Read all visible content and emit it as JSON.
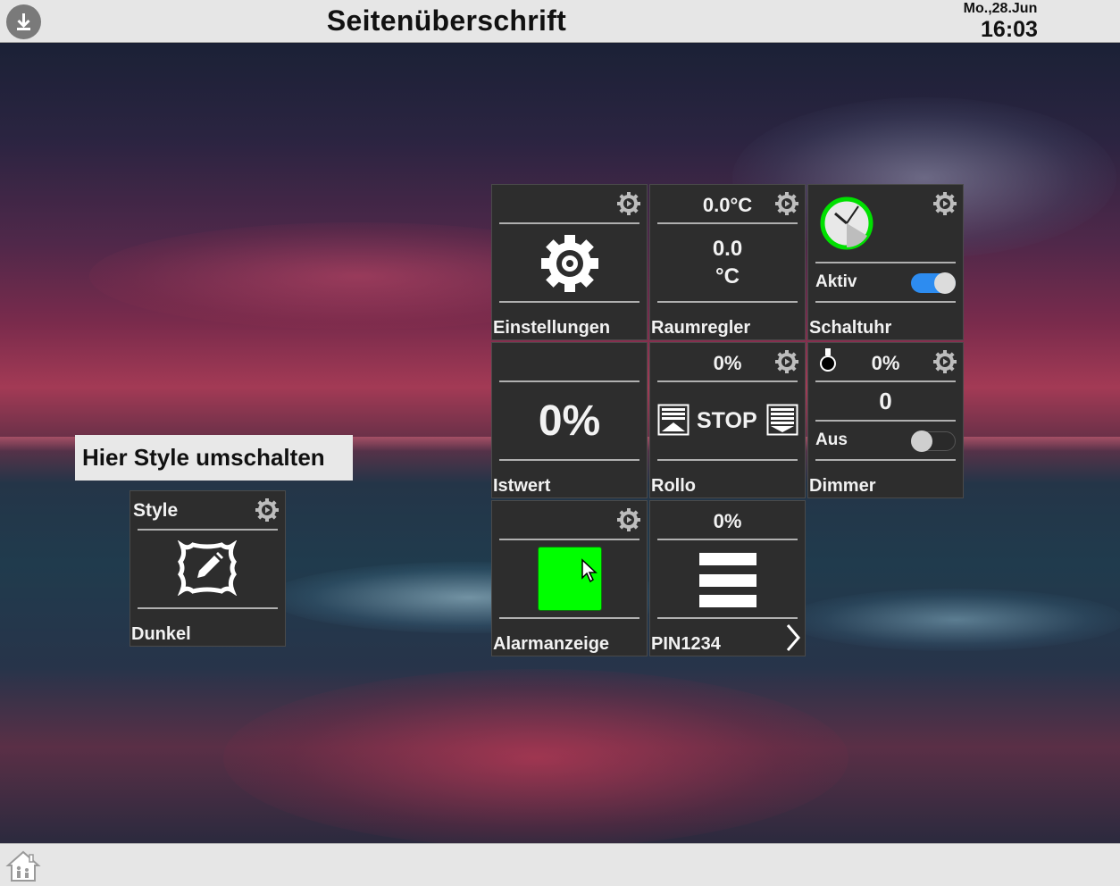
{
  "header": {
    "title": "Seitenüberschrift",
    "date": "Mo.,28.Jun",
    "time": "16:03"
  },
  "hint": {
    "text": "Hier Style umschalten"
  },
  "tiles": {
    "style": {
      "title": "Style",
      "label": "Dunkel"
    },
    "einstellungen": {
      "label": "Einstellungen"
    },
    "raumregler": {
      "top_value": "0.0°C",
      "value_line1": "0.0",
      "value_line2": "°C",
      "label": "Raumregler"
    },
    "schaltuhr": {
      "status": "Aktiv",
      "toggle_on": true,
      "label": "Schaltuhr"
    },
    "istwert": {
      "value": "0%",
      "label": "Istwert"
    },
    "rollo": {
      "top_value": "0%",
      "stop_label": "STOP",
      "label": "Rollo"
    },
    "dimmer": {
      "top_value": "0%",
      "value": "0",
      "status": "Aus",
      "toggle_on": false,
      "label": "Dimmer"
    },
    "alarmanzeige": {
      "label": "Alarmanzeige",
      "indicator_color": "#00ff00"
    },
    "pin": {
      "top_value": "0%",
      "label": "PIN1234"
    }
  },
  "icons": {
    "header_left": "download-icon",
    "footer_left": "home-icon",
    "tile_settings": "gear-icon"
  },
  "colors": {
    "tile_background": "#2d2d2d",
    "bar_background": "#e6e6e6",
    "toggle_active": "#2d8cf0",
    "clock_ring": "#00e000",
    "alarm_green": "#00ff00"
  }
}
